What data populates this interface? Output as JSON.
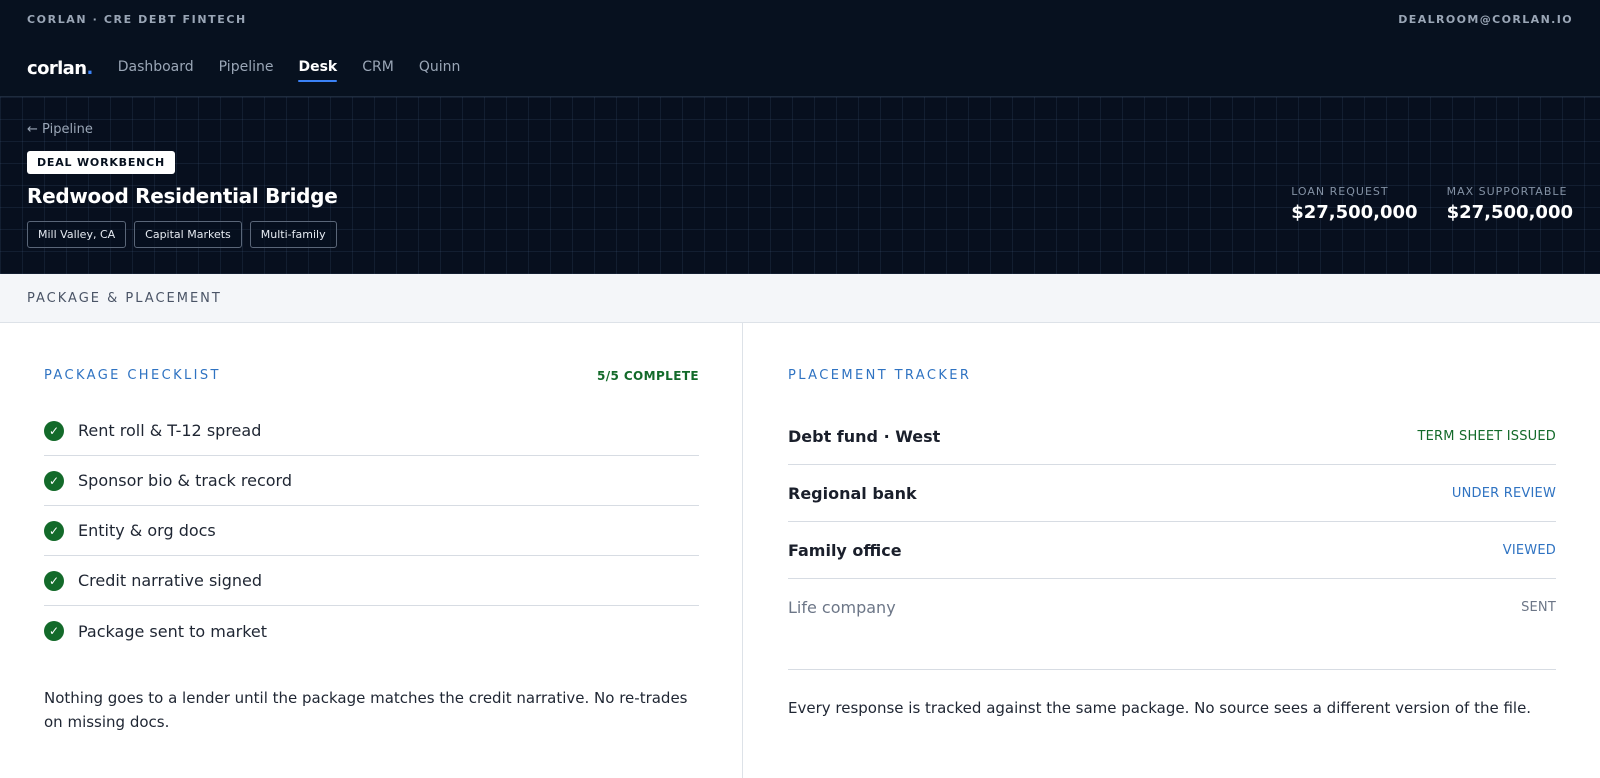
{
  "header": {
    "eyebrow": "CORLAN · CRE DEBT FINTECH",
    "email": "DEALROOM@CORLAN.IO",
    "logo_text": "corlan",
    "logo_dot": ".",
    "nav": [
      {
        "label": "Dashboard",
        "active": false
      },
      {
        "label": "Pipeline",
        "active": false
      },
      {
        "label": "Desk",
        "active": true
      },
      {
        "label": "CRM",
        "active": false
      },
      {
        "label": "Quinn",
        "active": false
      }
    ]
  },
  "hero": {
    "back_label": "← Pipeline",
    "badge": "DEAL WORKBENCH",
    "title": "Redwood Residential Bridge",
    "tags": [
      "Mill Valley, CA",
      "Capital Markets",
      "Multi-family"
    ],
    "metrics": [
      {
        "label": "LOAN REQUEST",
        "value": "$27,500,000"
      },
      {
        "label": "MAX SUPPORTABLE",
        "value": "$27,500,000"
      }
    ]
  },
  "section": {
    "title": "PACKAGE & PLACEMENT"
  },
  "checklist": {
    "title": "PACKAGE CHECKLIST",
    "status": "5/5 COMPLETE",
    "check_glyph": "✓",
    "items": [
      "Rent roll & T-12 spread",
      "Sponsor bio & track record",
      "Entity & org docs",
      "Credit narrative signed",
      "Package sent to market"
    ],
    "note": "Nothing goes to a lender until the package matches the credit narrative. No re-trades on missing docs."
  },
  "placement": {
    "title": "PLACEMENT TRACKER",
    "rows": [
      {
        "name": "Debt fund · West",
        "status": "TERM SHEET ISSUED"
      },
      {
        "name": "Regional bank",
        "status": "UNDER REVIEW"
      },
      {
        "name": "Family office",
        "status": "VIEWED"
      },
      {
        "name": "Life company",
        "status": "SENT"
      }
    ],
    "note": "Every response is tracked against the same package. No source sees a different version of the file."
  },
  "colors": {
    "accent_blue": "#2f73c2",
    "nav_underline": "#3b82f6",
    "success_green": "#136a2a",
    "header_bg": "#07111f"
  }
}
